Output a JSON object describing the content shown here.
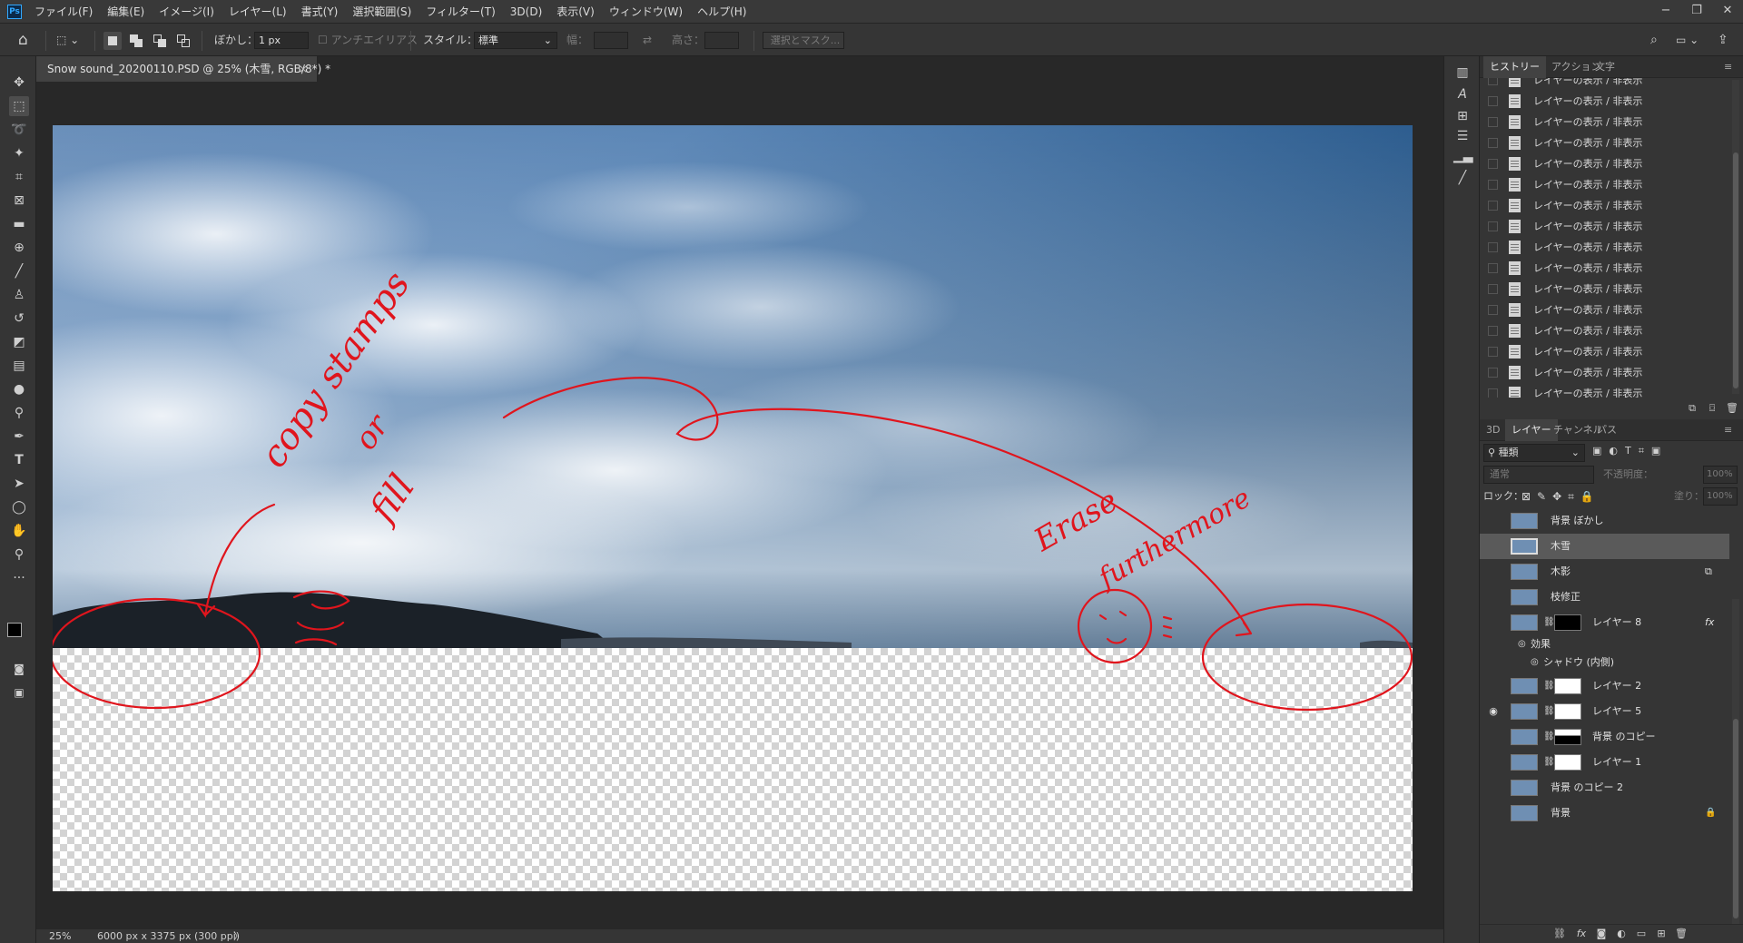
{
  "app": {
    "logo": "Ps"
  },
  "menu": [
    "ファイル(F)",
    "編集(E)",
    "イメージ(I)",
    "レイヤー(L)",
    "書式(Y)",
    "選択範囲(S)",
    "フィルター(T)",
    "3D(D)",
    "表示(V)",
    "ウィンドウ(W)",
    "ヘルプ(H)"
  ],
  "window_controls": {
    "minimize": "−",
    "restore": "❐",
    "close": "✕"
  },
  "options_bar": {
    "feather_label": "ぼかし：",
    "feather_value": "1 px",
    "antialias_label": "アンチエイリアス",
    "style_label": "スタイル：",
    "style_value": "標準",
    "width_label": "幅：",
    "height_label": "高さ：",
    "select_mask_label": "選択とマスク..."
  },
  "document": {
    "tab_title": "Snow sound_20200110.PSD @ 25% (木雪, RGB/8*) *",
    "tab_close": "×"
  },
  "annotations": {
    "left_text": [
      "copy stamps",
      "or",
      "fill"
    ],
    "right_text": [
      "Erase",
      "furthermore"
    ]
  },
  "status": {
    "zoom": "25%",
    "doc_info": "6000 px x 3375 px (300 ppi)",
    "arrow": "〉"
  },
  "history_panel": {
    "tabs": [
      "ヒストリー",
      "アクション",
      "文字"
    ],
    "items": [
      "レイヤーの表示 / 非表示",
      "レイヤーの表示 / 非表示",
      "レイヤーの表示 / 非表示",
      "レイヤーの表示 / 非表示",
      "レイヤーの表示 / 非表示",
      "レイヤーの表示 / 非表示",
      "レイヤーの表示 / 非表示",
      "レイヤーの表示 / 非表示",
      "レイヤーの表示 / 非表示",
      "レイヤーの表示 / 非表示",
      "レイヤーの表示 / 非表示",
      "レイヤーの表示 / 非表示",
      "レイヤーの表示 / 非表示",
      "レイヤーの表示 / 非表示",
      "レイヤーの表示 / 非表示",
      "レイヤーの表示 / 非表示",
      "レイヤーの表示 / 非表示",
      "レイヤーの表示 / 非表示"
    ]
  },
  "layers_panel": {
    "tabs": [
      "3D",
      "レイヤー",
      "チャンネル",
      "パス"
    ],
    "filter_label": "種類",
    "blend_mode": "通常",
    "opacity_label": "不透明度：",
    "opacity_value": "100%",
    "lock_label": "ロック：",
    "fill_label": "塗り：",
    "fill_value": "100%",
    "layers": [
      {
        "name": "背景 ぼかし",
        "visible": false,
        "selected": false
      },
      {
        "name": "木雪",
        "visible": false,
        "selected": true
      },
      {
        "name": "木影",
        "visible": false,
        "selected": false
      },
      {
        "name": "枝修正",
        "visible": false,
        "selected": false
      },
      {
        "name": "レイヤー 8",
        "visible": false,
        "selected": false
      },
      {
        "name": "効果",
        "visible": false,
        "selected": false
      },
      {
        "name": "シャドウ (内側)",
        "visible": false,
        "selected": false
      },
      {
        "name": "レイヤー 2",
        "visible": false,
        "selected": false
      },
      {
        "name": "レイヤー 5",
        "visible": true,
        "selected": false
      },
      {
        "name": "背景 のコピー",
        "visible": false,
        "selected": false
      },
      {
        "name": "レイヤー 1",
        "visible": false,
        "selected": false
      },
      {
        "name": "背景 のコピー 2",
        "visible": false,
        "selected": false
      },
      {
        "name": "背景",
        "visible": false,
        "selected": false
      }
    ],
    "fx": "fx"
  },
  "colors": {
    "accent": "#31a8ff",
    "annotation": "#e0151d",
    "panel": "#353535",
    "canvas_bg": "#282828"
  }
}
